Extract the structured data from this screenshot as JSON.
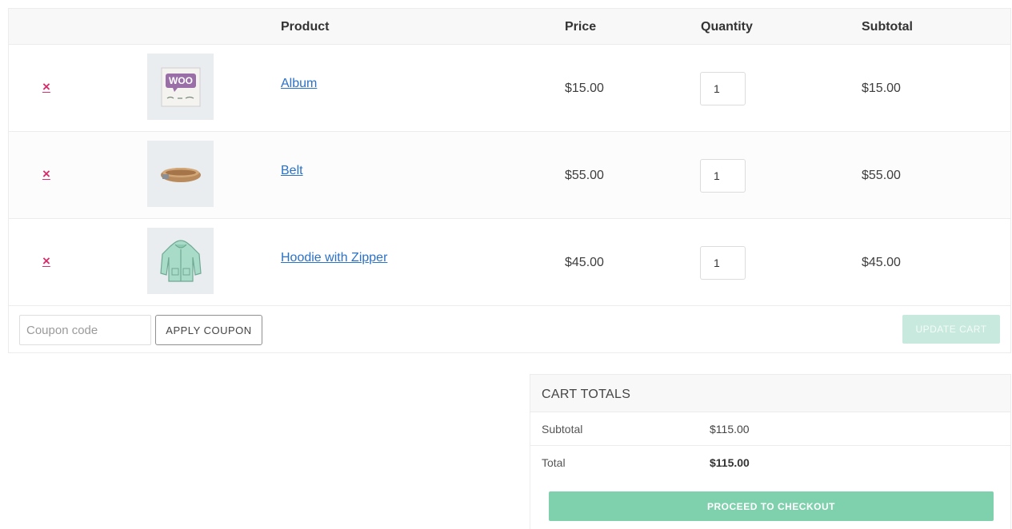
{
  "cart": {
    "headers": {
      "product": "Product",
      "price": "Price",
      "quantity": "Quantity",
      "subtotal": "Subtotal"
    },
    "remove_symbol": "×",
    "items": [
      {
        "name": "Album",
        "price": "$15.00",
        "quantity": "1",
        "subtotal": "$15.00",
        "thumbnail_icon": "album-woo-icon"
      },
      {
        "name": "Belt",
        "price": "$55.00",
        "quantity": "1",
        "subtotal": "$55.00",
        "thumbnail_icon": "belt-icon"
      },
      {
        "name": "Hoodie with Zipper",
        "price": "$45.00",
        "quantity": "1",
        "subtotal": "$45.00",
        "thumbnail_icon": "hoodie-icon"
      }
    ],
    "coupon": {
      "placeholder": "Coupon code",
      "apply_label": "APPLY COUPON"
    },
    "update_label": "UPDATE CART"
  },
  "totals": {
    "title": "CART TOTALS",
    "subtotal_label": "Subtotal",
    "subtotal_value": "$115.00",
    "total_label": "Total",
    "total_value": "$115.00",
    "checkout_label": "PROCEED TO CHECKOUT"
  },
  "colors": {
    "remove": "#d42f6c",
    "link": "#2b71c8",
    "checkout": "#7fd0ac",
    "update_disabled": "#c8e9de"
  },
  "logo_text": "Woo"
}
